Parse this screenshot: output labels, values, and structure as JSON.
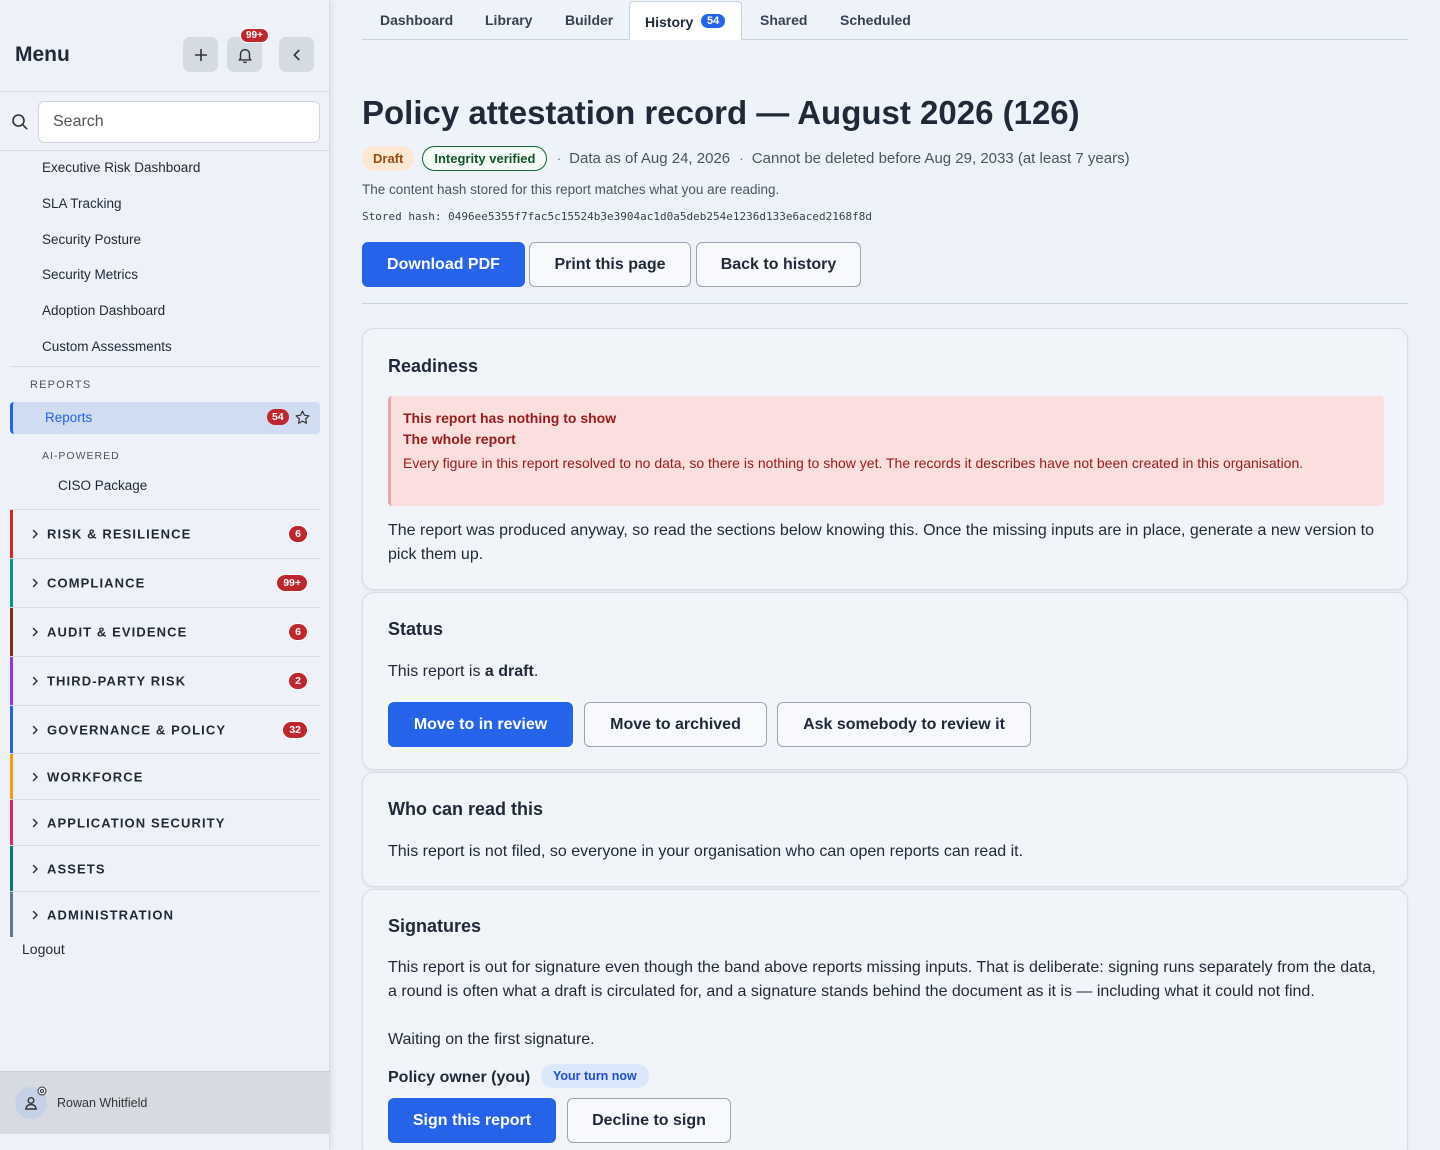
{
  "sidebar": {
    "title": "Menu",
    "notifications_badge": "99+",
    "search_placeholder": "Search",
    "links": [
      "Executive Risk Dashboard",
      "SLA Tracking",
      "Security Posture",
      "Security Metrics",
      "Adoption Dashboard",
      "Custom Assessments"
    ],
    "reports_section": "REPORTS",
    "reports_item": {
      "label": "Reports",
      "badge": "54"
    },
    "ai_section": "AI-POWERED",
    "ai_item": "CISO Package",
    "groups": [
      {
        "label": "RISK & RESILIENCE",
        "badge": "6",
        "color": "#dc2626"
      },
      {
        "label": "COMPLIANCE",
        "badge": "99+",
        "color": "#0d9488"
      },
      {
        "label": "AUDIT & EVIDENCE",
        "badge": "6",
        "color": "#7c2d12"
      },
      {
        "label": "THIRD-PARTY RISK",
        "badge": "2",
        "color": "#9333ea"
      },
      {
        "label": "GOVERNANCE & POLICY",
        "badge": "32",
        "color": "#2563eb"
      },
      {
        "label": "WORKFORCE",
        "badge": "",
        "color": "#f59e0b"
      },
      {
        "label": "APPLICATION SECURITY",
        "badge": "",
        "color": "#db2777"
      },
      {
        "label": "ASSETS",
        "badge": "",
        "color": "#0f766e"
      },
      {
        "label": "ADMINISTRATION",
        "badge": "",
        "color": "#64748b"
      }
    ],
    "logout": "Logout",
    "user": "Rowan Whitfield"
  },
  "tabs": {
    "dashboard": "Dashboard",
    "library": "Library",
    "builder": "Builder",
    "history": "History",
    "history_badge": "54",
    "shared": "Shared",
    "scheduled": "Scheduled"
  },
  "report": {
    "title": "Policy attestation record — August 2026 (126)",
    "draft_pill": "Draft",
    "verified_pill": "Integrity verified",
    "separator": "·",
    "data_as_of": "Data as of Aug 24, 2026",
    "retention": "Cannot be deleted before Aug 29, 2033 (at least 7 years)",
    "hash_note": "The content hash stored for this report matches what you are reading.",
    "hash_label": "Stored hash:",
    "hash_value": "0496ee5355f7fac5c15524b3e3904ac1d0a5deb254e1236d133e6aced2168f8d",
    "download_pdf": "Download PDF",
    "print_page": "Print this page",
    "back_history": "Back to history"
  },
  "readiness": {
    "title": "Readiness",
    "alert_title": "This report has nothing to show",
    "alert_subtitle": "The whole report",
    "alert_text": "Every figure in this report resolved to no data, so there is nothing to show yet. The records it describes have not been created in this organisation.",
    "body": "The report was produced anyway, so read the sections below knowing this. Once the missing inputs are in place, generate a new version to pick them up."
  },
  "status": {
    "title": "Status",
    "text_prefix": "This report is ",
    "text_bold": "a draft",
    "text_suffix": ".",
    "move_review": "Move to in review",
    "move_archived": "Move to archived",
    "ask_review": "Ask somebody to review it"
  },
  "access": {
    "title": "Who can read this",
    "text": "This report is not filed, so everyone in your organisation who can open reports can read it."
  },
  "signatures": {
    "title": "Signatures",
    "text": "This report is out for signature even though the band above reports missing inputs. That is deliberate: signing runs separately from the data, a round is often what a draft is circulated for, and a signature stands behind the document as it is — including what it could not find.",
    "waiting": "Waiting on the first signature.",
    "owner": "Policy owner (you)",
    "turn_pill": "Your turn now",
    "sign": "Sign this report",
    "decline": "Decline to sign"
  }
}
